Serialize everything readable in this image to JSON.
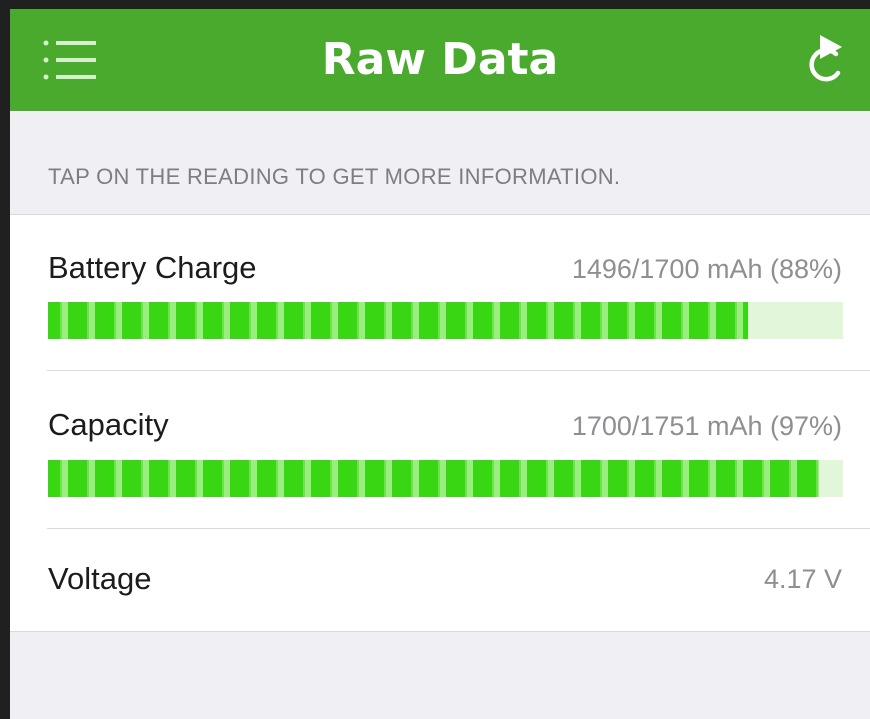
{
  "navbar": {
    "title": "Raw Data",
    "menu_icon": "hamburger-menu-icon",
    "refresh_icon": "refresh-icon",
    "background_color": "#4aaa2d"
  },
  "section": {
    "header": "TAP ON THE READING TO GET MORE INFORMATION."
  },
  "readings": [
    {
      "label": "Battery Charge",
      "value": "1496/1700 mAh (88%)",
      "fill_fraction": 0.88
    },
    {
      "label": "Capacity",
      "value": "1700/1751 mAh (97%)",
      "fill_fraction": 0.97
    },
    {
      "label": "Voltage",
      "value": "4.17 V"
    }
  ],
  "colors": {
    "bar_fill": "#39d614",
    "bar_track": "#e2f7d9"
  }
}
